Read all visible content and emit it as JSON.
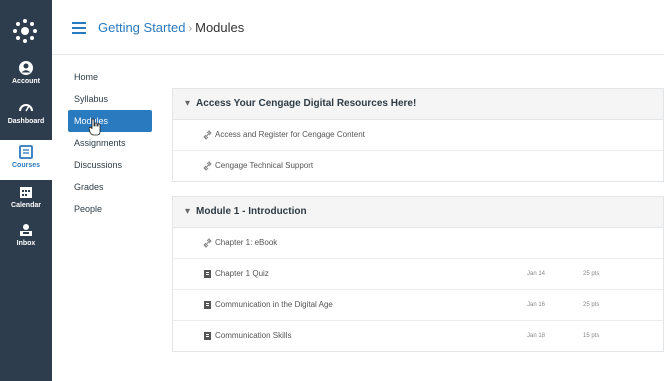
{
  "global_nav": {
    "items": [
      {
        "label": "Account",
        "icon": "account-icon"
      },
      {
        "label": "Dashboard",
        "icon": "dashboard-icon"
      },
      {
        "label": "Courses",
        "icon": "courses-icon"
      },
      {
        "label": "Calendar",
        "icon": "calendar-icon"
      },
      {
        "label": "Inbox",
        "icon": "inbox-icon"
      }
    ]
  },
  "header": {
    "breadcrumb_course": "Getting Started",
    "breadcrumb_separator": "›",
    "breadcrumb_page": "Modules"
  },
  "course_nav": {
    "items": [
      "Home",
      "Syllabus",
      "Modules",
      "Assignments",
      "Discussions",
      "Grades",
      "People"
    ]
  },
  "modules": [
    {
      "title": "Access Your Cengage Digital Resources Here!",
      "items": [
        {
          "icon": "link-icon",
          "title": "Access and Register for Cengage Content"
        },
        {
          "icon": "link-icon",
          "title": "Cengage Technical Support"
        }
      ]
    },
    {
      "title": "Module 1 - Introduction",
      "items": [
        {
          "icon": "link-icon",
          "title": "Chapter 1: eBook"
        },
        {
          "icon": "quiz-icon",
          "title": "Chapter 1 Quiz",
          "date": "Jan 14",
          "points": "25 pts"
        },
        {
          "icon": "quiz-icon",
          "title": "Communication in the Digital Age",
          "date": "Jan 16",
          "points": "25 pts"
        },
        {
          "icon": "quiz-icon",
          "title": "Communication Skills",
          "date": "Jan 18",
          "points": "15 pts"
        }
      ]
    }
  ],
  "colors": {
    "nav_bg": "#2e3d4d",
    "accent": "#2a7abf"
  }
}
